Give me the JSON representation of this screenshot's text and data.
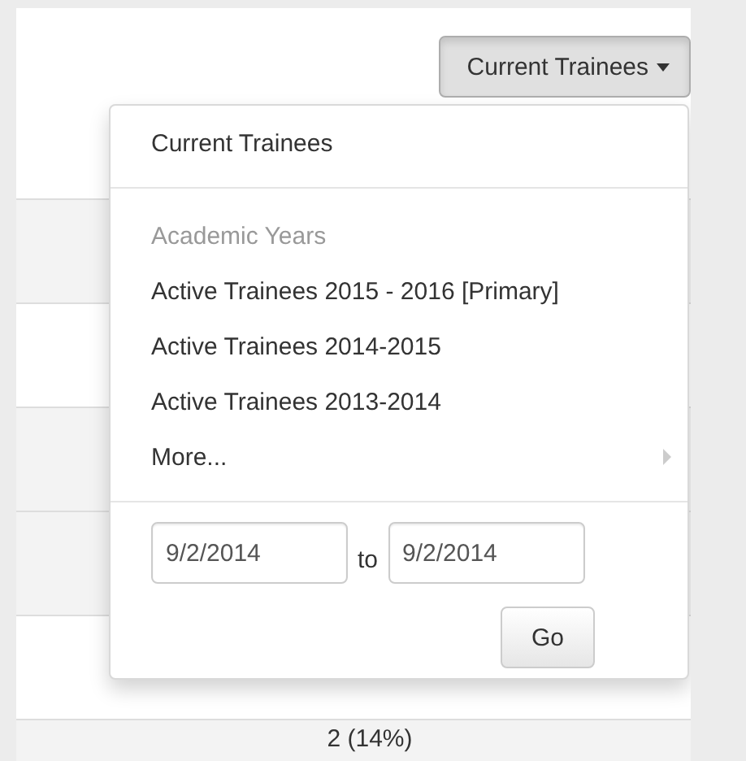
{
  "filter_button": {
    "label": "Current Trainees",
    "expanded": true
  },
  "menu": {
    "items": [
      {
        "kind": "item",
        "label": "Current Trainees"
      },
      {
        "kind": "divider"
      },
      {
        "kind": "header",
        "label": "Academic Years"
      },
      {
        "kind": "item",
        "label": "Active Trainees 2015 - 2016 [Primary]"
      },
      {
        "kind": "item",
        "label": "Active Trainees 2014-2015"
      },
      {
        "kind": "item",
        "label": "Active Trainees 2013-2014"
      },
      {
        "kind": "submenu",
        "label": "More..."
      },
      {
        "kind": "divider"
      }
    ],
    "date_range": {
      "from": "9/2/2014",
      "separator": "to",
      "to": "9/2/2014"
    },
    "go_button": "Go"
  },
  "table": {
    "rows": [
      {
        "striped": true
      },
      {
        "striped": false
      },
      {
        "striped": true
      },
      {
        "striped": true
      },
      {
        "striped": false
      },
      {
        "striped": true,
        "cell": "2 (14%)"
      }
    ]
  }
}
